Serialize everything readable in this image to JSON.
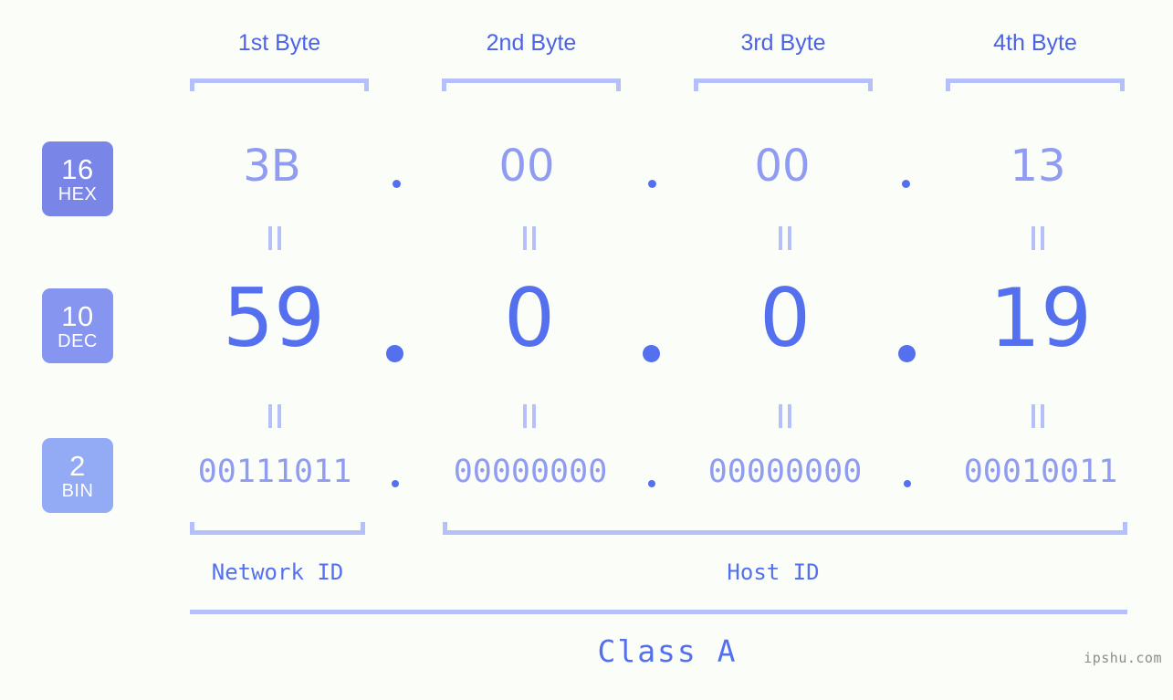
{
  "watermark": "ipshu.com",
  "byte_headers": [
    {
      "label": "1st Byte"
    },
    {
      "label": "2nd Byte"
    },
    {
      "label": "3rd Byte"
    },
    {
      "label": "4th Byte"
    }
  ],
  "bases": [
    {
      "num": "16",
      "abbr": "HEX",
      "color": "#7986e8"
    },
    {
      "num": "10",
      "abbr": "DEC",
      "color": "#8595f0"
    },
    {
      "num": "2",
      "abbr": "BIN",
      "color": "#93aaf5"
    }
  ],
  "rows": {
    "hex": {
      "values": [
        "3B",
        "00",
        "00",
        "13"
      ]
    },
    "dec": {
      "values": [
        "59",
        "0",
        "0",
        "19"
      ]
    },
    "bin": {
      "values": [
        "00111011",
        "00000000",
        "00000000",
        "00010011"
      ]
    }
  },
  "separator": ".",
  "equals_symbol": "=",
  "segments": {
    "network_id": "Network ID",
    "host_id": "Host ID"
  },
  "class_label": "Class A",
  "colors": {
    "background": "#fbfdf8",
    "header_blue": "#4c63e6",
    "bracket_blue": "#b5c0fb",
    "value_light": "#8f9cf2",
    "value_strong": "#5470ef",
    "watermark_gray": "#8c8c8c"
  }
}
